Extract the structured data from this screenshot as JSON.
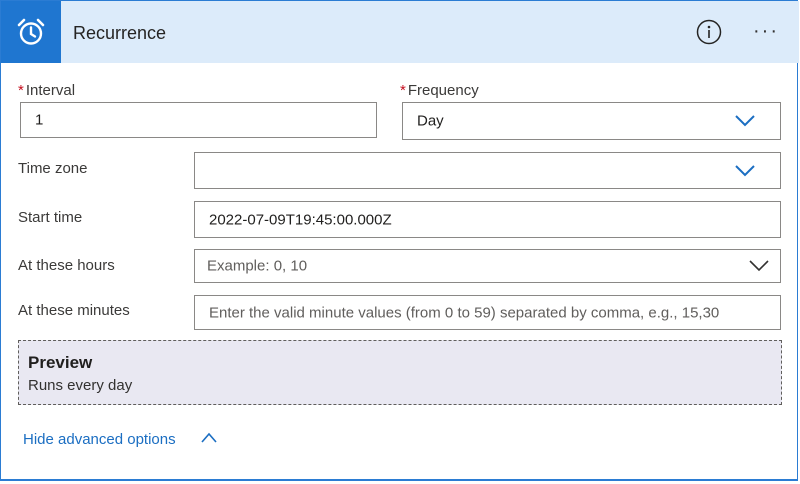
{
  "header": {
    "title": "Recurrence",
    "icon": "alarm-clock-icon",
    "info_icon": "info-icon",
    "more_label": "···",
    "accent": "#1f76d0",
    "bg": "#dcebfa"
  },
  "interval": {
    "label": "Interval",
    "required_mark": "*",
    "value": "1"
  },
  "frequency": {
    "label": "Frequency",
    "required_mark": "*",
    "value": "Day"
  },
  "time_zone": {
    "label": "Time zone",
    "value": ""
  },
  "start_time": {
    "label": "Start time",
    "value": "2022-07-09T19:45:00.000Z"
  },
  "at_hours": {
    "label": "At these hours",
    "placeholder": "Example: 0, 10"
  },
  "at_minutes": {
    "label": "At these minutes",
    "placeholder": "Enter the valid minute values (from 0 to 59) separated by comma, e.g., 15,30"
  },
  "preview": {
    "title": "Preview",
    "text": "Runs every day"
  },
  "advanced": {
    "label": "Hide advanced options"
  }
}
